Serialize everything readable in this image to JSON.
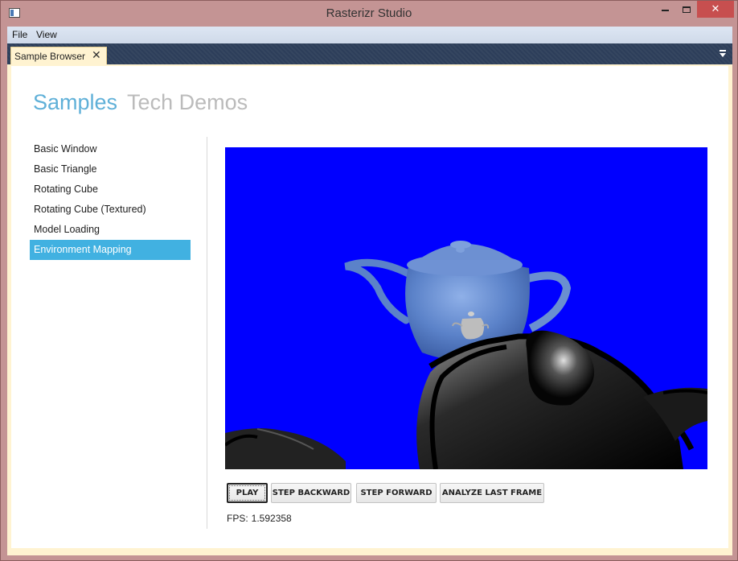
{
  "window": {
    "title": "Rasterizr Studio",
    "close_glyph": "✕",
    "min_icon": "minimize-icon",
    "max_icon": "maximize-icon"
  },
  "menu": [
    "File",
    "View"
  ],
  "doc_tab": {
    "label": "Sample Browser",
    "close_glyph": "✕"
  },
  "header": {
    "active": "Samples",
    "inactive": "Tech Demos"
  },
  "samples": [
    "Basic Window",
    "Basic Triangle",
    "Rotating Cube",
    "Rotating Cube (Textured)",
    "Model Loading",
    "Environment Mapping"
  ],
  "selected_sample_index": 5,
  "buttons": {
    "play": "PLAY",
    "step_backward": "STEP BACKWARD",
    "step_forward": "STEP FORWARD",
    "analyze": "ANALYZE LAST FRAME"
  },
  "status": {
    "fps_label": "FPS:",
    "fps_value": "1.592358"
  },
  "colors": {
    "accent": "#41b1e1",
    "viewport_bg": "#0000ff",
    "teapot": "#5b82c9",
    "window_frame": "#c49494"
  }
}
